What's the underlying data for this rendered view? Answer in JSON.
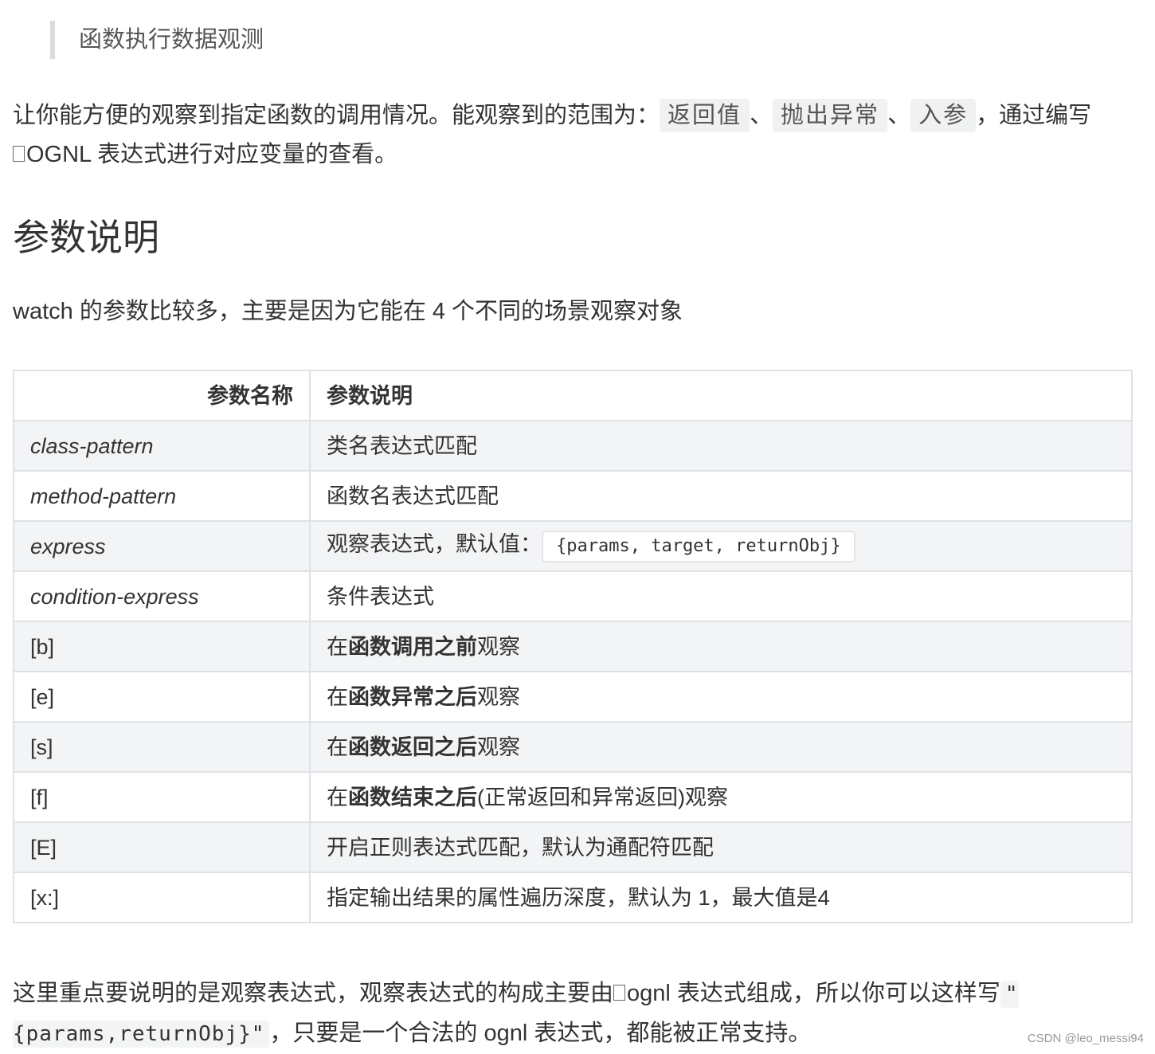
{
  "quote": "函数执行数据观测",
  "intro": {
    "before": "让你能方便的观察到指定函数的调用情况。能观察到的范围为：",
    "chip1": "返回值",
    "sep1": "、",
    "chip2": "抛出异常",
    "sep2": "、",
    "chip3": "入参",
    "after": "，通过编写",
    "line2": "OGNL 表达式进行对应变量的查看。"
  },
  "heading": "参数说明",
  "watch_line": "watch 的参数比较多，主要是因为它能在 4 个不同的场景观察对象",
  "table": {
    "headers": [
      "参数名称",
      "参数说明"
    ],
    "rows": [
      {
        "name": "class-pattern",
        "desc": "类名表达式匹配"
      },
      {
        "name": "method-pattern",
        "desc": "函数名表达式匹配"
      },
      {
        "name": "express",
        "desc_prefix": "观察表达式，默认值：",
        "code": "{params, target, returnObj}"
      },
      {
        "name": "condition-express",
        "desc": "条件表达式"
      },
      {
        "name": "[b]",
        "pre": "在",
        "bold": "函数调用之前",
        "post": "观察"
      },
      {
        "name": "[e]",
        "pre": "在",
        "bold": "函数异常之后",
        "post": "观察"
      },
      {
        "name": "[s]",
        "pre": "在",
        "bold": "函数返回之后",
        "post": "观察"
      },
      {
        "name": "[f]",
        "pre": "在",
        "bold": "函数结束之后",
        "post": "(正常返回和异常返回)观察"
      },
      {
        "name": "[E]",
        "desc": "开启正则表达式匹配，默认为通配符匹配"
      },
      {
        "name": "[x:]",
        "desc": "指定输出结果的属性遍历深度，默认为 1，最大值是4"
      }
    ]
  },
  "outro": {
    "before": "这里重点要说明的是观察表达式，观察表达式的构成主要由",
    "middle": "ognl 表达式组成，所以你可以这样写",
    "code": "\"{params,returnObj}\"",
    "after": "，只要是一个合法的 ognl 表达式，都能被正常支持。"
  },
  "watermark": "CSDN @leo_messi94"
}
